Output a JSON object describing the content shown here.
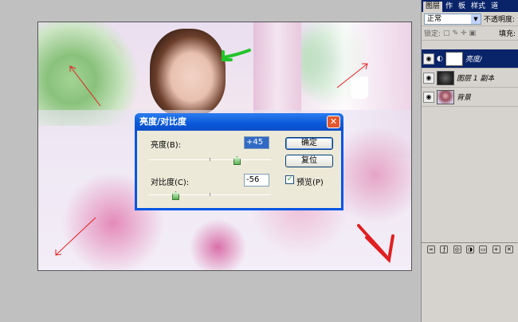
{
  "dialog": {
    "title": "亮度/对比度",
    "close_glyph": "✕",
    "brightness_label": "亮度(B):",
    "brightness_value": "+45",
    "contrast_label": "对比度(C):",
    "contrast_value": "-56",
    "ok_label": "确定",
    "reset_label": "复位",
    "preview_label": "预览(P)",
    "preview_checked": true
  },
  "layers_panel": {
    "tabs": [
      "图层",
      "作",
      "板",
      "样式",
      "道"
    ],
    "blend_mode": "正常",
    "opacity_label": "不透明度:",
    "lock_label": "锁定:",
    "fill_label": "填充:",
    "layers": [
      {
        "name": "亮度/",
        "selected": true,
        "thumb": "white"
      },
      {
        "name": "图层 1 副本",
        "selected": false,
        "thumb": "dark"
      },
      {
        "name": "背景",
        "selected": false,
        "thumb": "photo"
      }
    ]
  },
  "colors": {
    "titlebar": "#0a58d8",
    "annotation_red": "#e02020",
    "annotation_green": "#22c42a"
  }
}
